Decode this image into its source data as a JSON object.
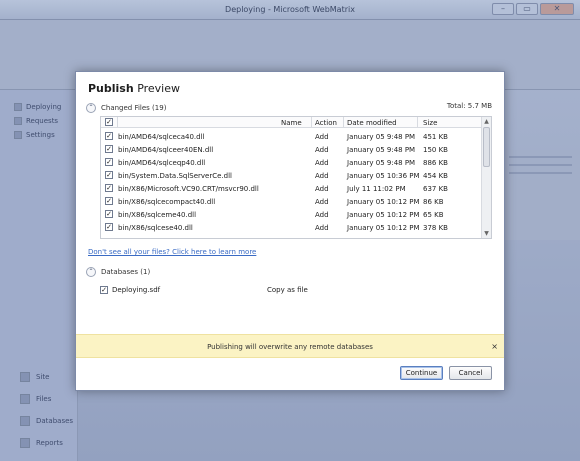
{
  "background": {
    "window_title": "Deploying - Microsoft WebMatrix",
    "controls": [
      "–",
      "▭",
      "✕"
    ],
    "side_items": [
      "Deploying",
      "Requests",
      "Settings"
    ],
    "bottom_items": [
      "Site",
      "Files",
      "Databases",
      "Reports"
    ]
  },
  "dialog": {
    "title_bold": "Publish",
    "title_rest": "Preview",
    "changed_files_label": "Changed Files (19)",
    "total_label": "Total: 5.7 MB",
    "columns": {
      "name": "Name",
      "action": "Action",
      "date": "Date modified",
      "size": "Size"
    },
    "files": [
      {
        "name": "bin/AMD64/sqlceca40.dll",
        "action": "Add",
        "date": "January 05 9:48 PM",
        "size": "451 KB"
      },
      {
        "name": "bin/AMD64/sqlceer40EN.dll",
        "action": "Add",
        "date": "January 05 9:48 PM",
        "size": "150 KB"
      },
      {
        "name": "bin/AMD64/sqlceqp40.dll",
        "action": "Add",
        "date": "January 05 9:48 PM",
        "size": "886 KB"
      },
      {
        "name": "bin/System.Data.SqlServerCe.dll",
        "action": "Add",
        "date": "January 05 10:36 PM",
        "size": "454 KB"
      },
      {
        "name": "bin/X86/Microsoft.VC90.CRT/msvcr90.dll",
        "action": "Add",
        "date": "July 11 11:02 PM",
        "size": "637 KB"
      },
      {
        "name": "bin/X86/sqlcecompact40.dll",
        "action": "Add",
        "date": "January 05 10:12 PM",
        "size": "86 KB"
      },
      {
        "name": "bin/X86/sqlceme40.dll",
        "action": "Add",
        "date": "January 05 10:12 PM",
        "size": "65 KB"
      },
      {
        "name": "bin/X86/sqlcese40.dll",
        "action": "Add",
        "date": "January 05 10:12 PM",
        "size": "378 KB"
      }
    ],
    "help_link": "Don't see all your files? Click here to learn more",
    "databases_label": "Databases (1)",
    "database": {
      "name": "Deploying.sdf",
      "action": "Copy as file"
    },
    "warning": "Publishing will overwrite any remote databases",
    "warning_close": "×",
    "continue_label": "Continue",
    "cancel_label": "Cancel",
    "check_mark": "✓",
    "collapse_glyph": "⌃",
    "scroll_up": "▲",
    "scroll_down": "▼"
  }
}
